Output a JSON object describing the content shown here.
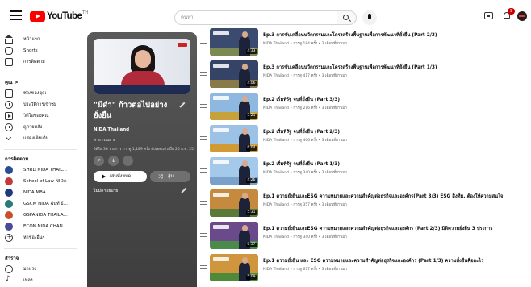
{
  "header": {
    "logo_text": "YouTube",
    "logo_region": "TH",
    "search_placeholder": "ค้นหา",
    "notification_count": "9"
  },
  "sidebar": {
    "main": [
      {
        "label": "หน้าแรก",
        "icon": "home-icon"
      },
      {
        "label": "Shorts",
        "icon": "shorts-icon"
      },
      {
        "label": "การติดตาม",
        "icon": "subscriptions-icon"
      }
    ],
    "you_header": "คุณ >",
    "you": [
      {
        "label": "ช่องของคุณ",
        "icon": "your-channel-icon"
      },
      {
        "label": "ประวัติการเข้าชม",
        "icon": "history-icon"
      },
      {
        "label": "วิดีโอของคุณ",
        "icon": "your-videos-icon"
      },
      {
        "label": "ดูภายหลัง",
        "icon": "watch-later-icon"
      },
      {
        "label": "แสดงเพิ่มเติม",
        "icon": "chevron-down-icon"
      }
    ],
    "subs_header": "การติดตาม",
    "subscriptions": [
      {
        "label": "SHRD NIDA THAIL...",
        "color": "#2a4d8f"
      },
      {
        "label": "School of Law NIDA",
        "color": "#c23b3b"
      },
      {
        "label": "NIDA MBA",
        "color": "#1e3a7a"
      },
      {
        "label": "GSCM NIDA ฉันท์ ธี...",
        "color": "#2a7a7a"
      },
      {
        "label": "GSPANIDA THAILA...",
        "color": "#c7502a"
      },
      {
        "label": "ECON NIDA CHAN...",
        "color": "#4a4a9a"
      }
    ],
    "browse_label": "หาช่องอื่นๆ",
    "explore_header": "สำรวจ",
    "explore": [
      {
        "label": "มาแรง",
        "icon": "trending-icon"
      },
      {
        "label": "เพลง",
        "icon": "music-icon"
      }
    ]
  },
  "playlist": {
    "title": "\"มีดำ\" ก้าวต่อไปอย่างยั่งยืน",
    "owner": "NIDA Thailand",
    "privacy": "สาธารณะ ∨",
    "stats": "วิดีโอ 36 รายการ  การดู 1,189 ครั้ง  อัปเดตแล้วเมื่อ 25 ธ.ค. 2566",
    "play_all": "เล่นทั้งหมด",
    "shuffle": "สุ่ม",
    "description": "ไม่มีคำอธิบาย"
  },
  "videos": [
    {
      "title": "Ep.3 การขับเคลื่อนนวัตกรรมและโครงสร้างพื้นฐานเพื่อการพัฒนาที่ยั่งยืน (Part 2/3)",
      "meta": "NIDA Thailand • การดู 184 ครั้ง • 3 เดือนที่ผ่านมา",
      "duration": "4:33",
      "sky": "#3b4b70",
      "band": "#7a8a52"
    },
    {
      "title": "Ep.3 การขับเคลื่อนนวัตกรรมและโครงสร้างพื้นฐานเพื่อการพัฒนาที่ยั่งยืน (Part 1/3)",
      "meta": "NIDA Thailand • การดู 417 ครั้ง • 3 เดือนที่ผ่านมา",
      "duration": "4:06",
      "sky": "#354466",
      "band": "#8a7a4a"
    },
    {
      "title": "Ep.2 เริ่มที่รัฐ จบที่ยั่งยืน (Part 3/3)",
      "meta": "NIDA Thailand • การดู 216 ครั้ง • 3 เดือนที่ผ่านมา",
      "duration": "5:21",
      "sky": "#8fb8e0",
      "band": "#c7a13a"
    },
    {
      "title": "Ep.2 เริ่มที่รัฐ จบที่ยั่งยืน (Part 2/3)",
      "meta": "NIDA Thailand • การดู 406 ครั้ง • 3 เดือนที่ผ่านมา",
      "duration": "6:04",
      "sky": "#9cc3e6",
      "band": "#d29a34"
    },
    {
      "title": "Ep.2 เริ่มที่รัฐ จบที่ยั่งยืน (Part 1/3)",
      "meta": "NIDA Thailand • การดู 340 ครั้ง • 3 เดือนที่ผ่านมา",
      "duration": "4:26",
      "sky": "#a5c9ea",
      "band": "#7aa1c9"
    },
    {
      "title": "Ep.1 ความยั่งยืนและESG ความหมายและความสำคัญต่อธุรกิจและองค์กร(Part 3/3) ESG สิ่งที่ม..ต้องให้ความสนใจ",
      "meta": "NIDA Thailand • การดู 357 ครั้ง • 3 เดือนที่ผ่านมา",
      "duration": "5:31",
      "sky": "#c58a3e",
      "band": "#5a7a3a"
    },
    {
      "title": "Ep.1 ความยั่งยืนและESG ความหมายและความสำคัญต่อธุรกิจและองค์กร (Part 2/3) มิติความยั่งยืน 3 ประการ",
      "meta": "NIDA Thailand • การดู 340 ครั้ง • 3 เดือนที่ผ่านมา",
      "duration": "6:57",
      "sky": "#6a4a8a",
      "band": "#4a8a4a"
    },
    {
      "title": "Ep.1 ความยั่งยืน และ ESG ความหมายและความสำคัญต่อธุรกิจและองค์กร (Part 1/3) ความยั่งยืนคืออะไร",
      "meta": "NIDA Thailand • การดู 677 ครั้ง • 3 เดือนที่ผ่านมา",
      "duration": "5:09",
      "sky": "#d0963e",
      "band": "#4f8a3a"
    }
  ]
}
